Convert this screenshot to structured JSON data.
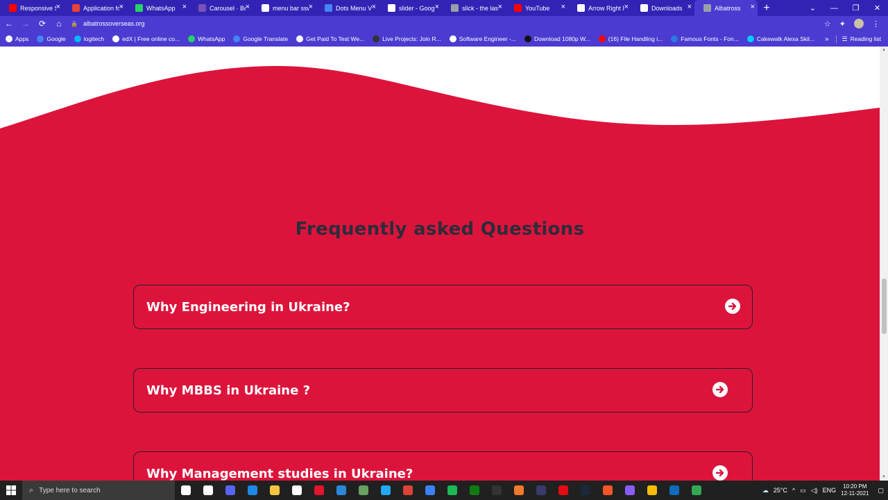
{
  "browser": {
    "tabs": [
      {
        "label": "Responsive Sl",
        "icon": "youtube-icon",
        "color": "#ff0000"
      },
      {
        "label": "Application fo",
        "icon": "gmail-icon",
        "color": "#ea4335"
      },
      {
        "label": "WhatsApp",
        "icon": "whatsapp-icon",
        "color": "#25d366"
      },
      {
        "label": "Carousel · Boo",
        "icon": "bootstrap-icon",
        "color": "#7952b3"
      },
      {
        "label": "menu bar ssw",
        "icon": "google-icon",
        "color": "#ffffff"
      },
      {
        "label": "Dots Menu Ve",
        "icon": "grid-icon",
        "color": "#4285f4"
      },
      {
        "label": "slider - Googl",
        "icon": "google-icon",
        "color": "#ffffff"
      },
      {
        "label": "slick - the last",
        "icon": "globe-icon",
        "color": "#9aa0a6"
      },
      {
        "label": "YouTube",
        "icon": "youtube-icon",
        "color": "#ff0000"
      },
      {
        "label": "Arrow Right I",
        "icon": "flag-icon",
        "color": "#ffffff"
      },
      {
        "label": "Downloads",
        "icon": "download-icon",
        "color": "#ffffff"
      },
      {
        "label": "Albatross",
        "icon": "globe-icon",
        "color": "#9aa0a6",
        "active": true
      }
    ],
    "url": "albatrossoverseas.org",
    "bookmarks": [
      {
        "label": "Apps",
        "color": "#ffffff"
      },
      {
        "label": "Google",
        "color": "#4285f4"
      },
      {
        "label": "logitech",
        "color": "#00b8fc"
      },
      {
        "label": "edX | Free online co...",
        "color": "#ffffff"
      },
      {
        "label": "WhatsApp",
        "color": "#25d366"
      },
      {
        "label": "Google Translate",
        "color": "#4285f4"
      },
      {
        "label": "Get Paid To Test We...",
        "color": "#ffffff"
      },
      {
        "label": "Live Projects: Join R...",
        "color": "#333333"
      },
      {
        "label": "Software Engineer -...",
        "color": "#ffffff"
      },
      {
        "label": "Download 1080p W...",
        "color": "#111111"
      },
      {
        "label": "(16) File Handling i...",
        "color": "#ff0000"
      },
      {
        "label": "Famous Fonts - Fon...",
        "color": "#2a7ae2"
      },
      {
        "label": "Cakewalk Alexa Skil...",
        "color": "#00caff"
      }
    ],
    "more": "»",
    "reading_list": "Reading list"
  },
  "page": {
    "faq_title": "Frequently asked Questions",
    "faq_items": [
      {
        "question": "Why Engineering in Ukraine?"
      },
      {
        "question": "Why MBBS in Ukraine ?"
      },
      {
        "question": "Why Management studies in Ukraine?"
      }
    ],
    "colors": {
      "accent": "#dc143c",
      "title": "#2c2c3a",
      "white": "#ffffff"
    }
  },
  "taskbar": {
    "search_placeholder": "Type here to search",
    "weather": "25°C",
    "language": "ENG",
    "time": "10:20 PM",
    "date": "12-11-2021",
    "apps": [
      {
        "name": "cortana-icon",
        "color": "#ffffff"
      },
      {
        "name": "task-view-icon",
        "color": "#ffffff"
      },
      {
        "name": "discord-icon",
        "color": "#5865f2"
      },
      {
        "name": "notepad-icon",
        "color": "#1e88e5"
      },
      {
        "name": "file-explorer-icon",
        "color": "#f4c542"
      },
      {
        "name": "store-icon",
        "color": "#ffffff"
      },
      {
        "name": "opera-icon",
        "color": "#e3142d"
      },
      {
        "name": "mail-icon",
        "color": "#2b88d8"
      },
      {
        "name": "nodejs-icon",
        "color": "#68a063"
      },
      {
        "name": "vscode-icon",
        "color": "#23a9f2"
      },
      {
        "name": "chrome-icon",
        "color": "#db4437"
      },
      {
        "name": "todo-icon",
        "color": "#3b82f6"
      },
      {
        "name": "spotify-icon",
        "color": "#1db954"
      },
      {
        "name": "xbox-icon",
        "color": "#107c10"
      },
      {
        "name": "epic-games-icon",
        "color": "#333333"
      },
      {
        "name": "blender-icon",
        "color": "#f5792a"
      },
      {
        "name": "obs-icon",
        "color": "#3a3a6a"
      },
      {
        "name": "netflix-icon",
        "color": "#e50914"
      },
      {
        "name": "steam-icon",
        "color": "#1b2838"
      },
      {
        "name": "brave-icon",
        "color": "#fb542b"
      },
      {
        "name": "arc-icon",
        "color": "#8a5cf6"
      },
      {
        "name": "chrome-profile-icon",
        "color": "#fbbc05"
      },
      {
        "name": "media-player-icon",
        "color": "#0f6cbd"
      },
      {
        "name": "globe-app-icon",
        "color": "#34a853"
      }
    ]
  }
}
